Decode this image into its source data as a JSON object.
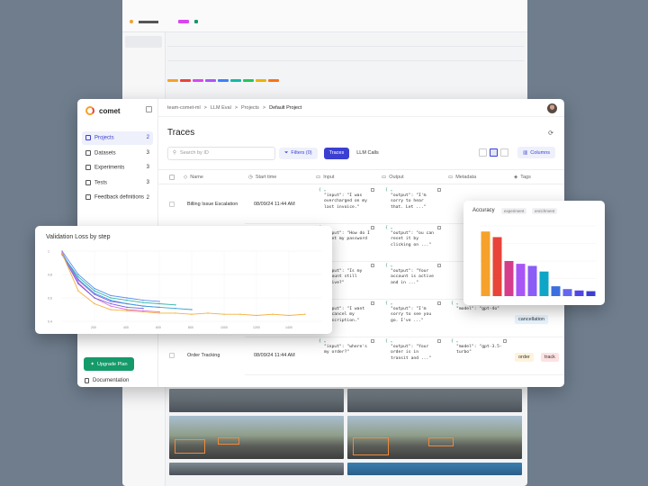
{
  "breadcrumb": [
    "team-comet-ml",
    "LLM Eval",
    "Projects",
    "Default Project"
  ],
  "app": {
    "logo_text": "comet"
  },
  "sidebar": {
    "items": [
      {
        "label": "Projects",
        "count": "2",
        "active": true
      },
      {
        "label": "Datasets",
        "count": "3",
        "active": false
      },
      {
        "label": "Experiments",
        "count": "3",
        "active": false
      },
      {
        "label": "Tests",
        "count": "3",
        "active": false
      },
      {
        "label": "Feedback definitions",
        "count": "2",
        "active": false
      }
    ],
    "upgrade_label": "Upgrade Plan",
    "docs_label": "Documentation"
  },
  "page": {
    "title": "Traces"
  },
  "toolbar": {
    "search_placeholder": "Search by ID",
    "filters_label": "Filters (0)",
    "tabs": [
      "Traces",
      "LLM Calls"
    ],
    "columns_label": "Columns"
  },
  "table": {
    "headers": [
      "Name",
      "Start time",
      "Input",
      "Output",
      "Metadata",
      "Tags"
    ],
    "rows": [
      {
        "name": "Billing Issue Escalation",
        "time": "08/09/24 11:44 AM",
        "input": [
          "\"input\": \"I was",
          "overcharged on my",
          "last invoice.\""
        ],
        "output": [
          "\"output\": \"I'm",
          "sorry to hear",
          "that. Let ...\""
        ]
      },
      {
        "name": "",
        "time": "",
        "input": [
          "\"input\": \"How do I",
          "reset my password",
          "?\""
        ],
        "output": [
          "\"output\": \"ou can",
          "reset it by",
          "clicking on ...\""
        ]
      },
      {
        "name": "",
        "time": "",
        "input": [
          "\"input\": \"Is my",
          "account still",
          "active?\""
        ],
        "output": [
          "\"output\": \"Your",
          "account is active",
          "and in ...\""
        ]
      },
      {
        "name": "",
        "time": "",
        "input": [
          "\"input\": \"I want",
          "to cancel my",
          "subscription.\""
        ],
        "output": [
          "\"output\": \"I'm",
          "sorry to see you",
          "go. I've ...\""
        ],
        "metadata": [
          "\"model\": \"gpt-4o\""
        ],
        "tags": [
          "cancellation"
        ]
      },
      {
        "name": "Order Tracking",
        "time": "08/09/24 11:44 AM",
        "input": [
          "\"input\": \"where's",
          "my order?\""
        ],
        "output": [
          "\"output\": \"Your",
          "order is in",
          "transit and ...\""
        ],
        "metadata": [
          "\"model\": \"gpt-3.5-",
          "turbo\""
        ],
        "tags": [
          "order",
          "track"
        ]
      }
    ]
  },
  "colors": {
    "accent": "#3b3fd1",
    "green": "#159a6a"
  },
  "loss_chart": {
    "chart_data": {
      "type": "line",
      "title": "Validation Loss by step",
      "ylim": [
        0.4,
        1.0
      ],
      "yticks": [
        "1",
        "0.8",
        "0.6",
        "0.4"
      ],
      "xlim": [
        0,
        1600
      ],
      "xticks": [
        "200",
        "400",
        "600",
        "800",
        "1000",
        "1200",
        "1400"
      ],
      "series": [
        {
          "color": "#5b8def",
          "x": [
            0,
            100,
            200,
            300,
            400,
            500,
            600
          ],
          "y": [
            1.0,
            0.8,
            0.68,
            0.62,
            0.6,
            0.58,
            0.57
          ]
        },
        {
          "color": "#8a5cf0",
          "x": [
            0,
            100,
            200,
            300,
            400,
            500,
            600
          ],
          "y": [
            0.98,
            0.75,
            0.63,
            0.57,
            0.55,
            0.53,
            0.52
          ]
        },
        {
          "color": "#31b5a8",
          "x": [
            0,
            100,
            200,
            300,
            400,
            500,
            600,
            700
          ],
          "y": [
            0.97,
            0.78,
            0.66,
            0.6,
            0.58,
            0.56,
            0.55,
            0.54
          ]
        },
        {
          "color": "#e46bd0",
          "x": [
            0,
            100,
            200,
            300,
            400,
            500,
            600
          ],
          "y": [
            0.99,
            0.73,
            0.6,
            0.53,
            0.5,
            0.49,
            0.48
          ]
        },
        {
          "color": "#3aa0d8",
          "x": [
            0,
            100,
            200,
            300,
            400,
            500,
            600,
            700,
            800
          ],
          "y": [
            0.98,
            0.76,
            0.64,
            0.58,
            0.55,
            0.53,
            0.52,
            0.51,
            0.5
          ]
        },
        {
          "color": "#6f62e0",
          "x": [
            0,
            100,
            200,
            300,
            400,
            500
          ],
          "y": [
            0.97,
            0.72,
            0.6,
            0.55,
            0.52,
            0.51
          ]
        },
        {
          "color": "#f5b03c",
          "x": [
            0,
            100,
            200,
            300,
            400,
            500,
            600,
            700,
            800,
            900,
            1000,
            1100,
            1200,
            1300,
            1400,
            1500
          ],
          "y": [
            0.98,
            0.66,
            0.55,
            0.5,
            0.49,
            0.48,
            0.47,
            0.47,
            0.46,
            0.47,
            0.46,
            0.46,
            0.45,
            0.46,
            0.45,
            0.46
          ]
        }
      ]
    }
  },
  "accuracy_chart": {
    "chart_data": {
      "type": "bar",
      "title": "Accuracy",
      "pills": [
        "experiment",
        "enrichment"
      ],
      "ylim": [
        0,
        1
      ],
      "values": [
        0.92,
        0.84,
        0.5,
        0.46,
        0.43,
        0.35,
        0.14,
        0.1,
        0.08,
        0.07
      ],
      "colors": [
        "#f6a12c",
        "#e8443a",
        "#d53d8c",
        "#a855f7",
        "#8b5cf6",
        "#0ea5c6",
        "#3b6fe0",
        "#6366f1",
        "#4f46e5",
        "#3b3fd1"
      ]
    }
  }
}
